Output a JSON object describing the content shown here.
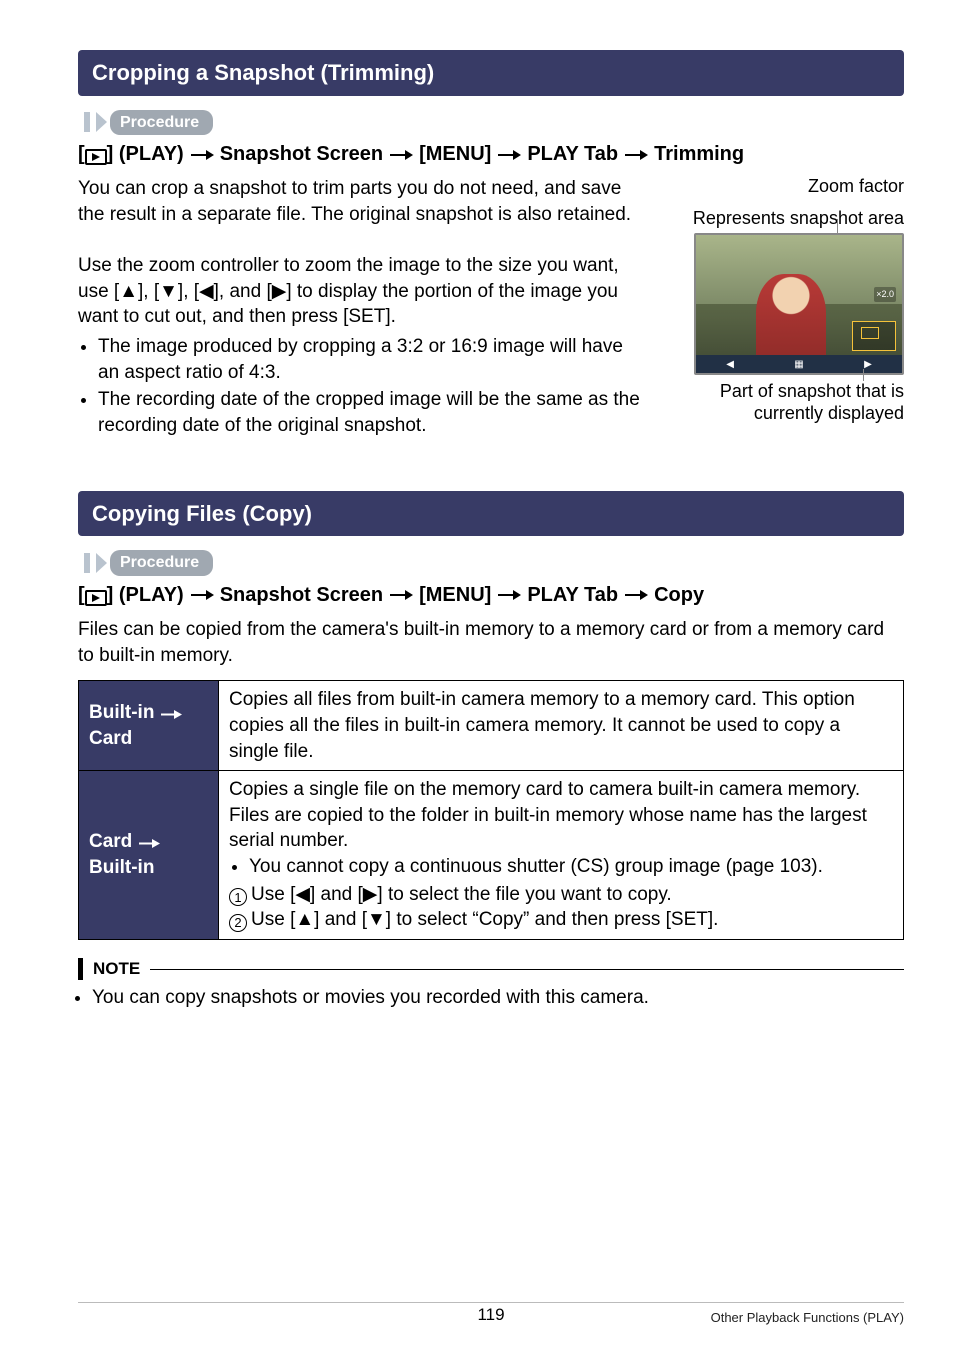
{
  "section1": {
    "title": "Cropping a Snapshot (Trimming)",
    "procedureLabel": "Procedure",
    "path": {
      "p1a": "[",
      "p1b": "] (PLAY)",
      "p2": "Snapshot Screen",
      "p3": "[MENU]",
      "p4": "PLAY Tab",
      "p5": "Trimming"
    },
    "intro": "You can crop a snapshot to trim parts you do not need, and save the result in a separate file. The original snapshot is also retained.",
    "zoomLabel": "Zoom factor",
    "repLabel": "Represents snapshot area",
    "body": "Use the zoom controller to zoom the image to the size you want, use [▲], [▼], [◀], and [▶] to display the portion of the image you want to cut out, and then press [SET].",
    "bullet1": "The image produced by cropping a 3:2 or 16:9 image will have an aspect ratio of 4:3.",
    "bullet2": "The recording date of the cropped image will be the same as the recording date of the original snapshot.",
    "partCaption": "Part of snapshot that is currently displayed",
    "thumbZoom": "×2.0"
  },
  "section2": {
    "title": "Copying Files (Copy)",
    "procedureLabel": "Procedure",
    "path": {
      "p1a": "[",
      "p1b": "] (PLAY)",
      "p2": "Snapshot Screen",
      "p3": "[MENU]",
      "p4": "PLAY Tab",
      "p5": "Copy"
    },
    "intro": "Files can be copied from the camera's built-in memory to a memory card or from a memory card to built-in memory.",
    "tbl": {
      "r1": {
        "hdr1": "Built-in",
        "hdr2": "Card",
        "body": "Copies all files from built-in camera memory to a memory card. This option copies all the files in built-in camera memory. It cannot be used to copy a single file."
      },
      "r2": {
        "hdr1": "Card",
        "hdr2": "Built-in",
        "p1": "Copies a single file on the memory card to camera built-in camera memory. Files are copied to the folder in built-in memory whose name has the largest serial number.",
        "b1": "You cannot copy a continuous shutter (CS) group image (page 103).",
        "s1": "Use [◀] and [▶] to select the file you want to copy.",
        "s2": "Use [▲] and [▼] to select “Copy” and then press [SET]."
      }
    },
    "noteLabel": "NOTE",
    "noteBullet": "You can copy snapshots or movies you recorded with this camera."
  },
  "footer": {
    "page": "119",
    "section": "Other Playback Functions (PLAY)"
  }
}
